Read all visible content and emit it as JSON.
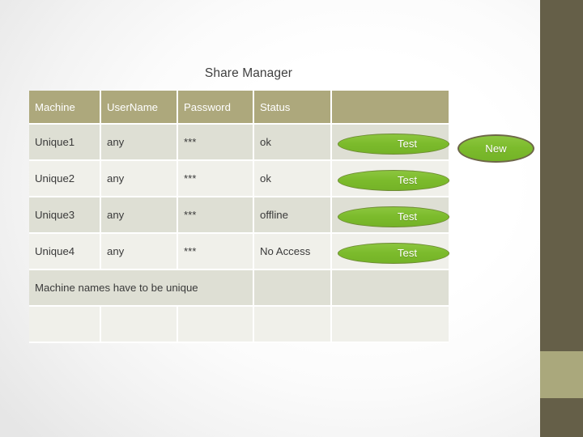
{
  "slide": {
    "title": "Share Manager"
  },
  "table": {
    "headers": [
      "Machine",
      "UserName",
      "Password",
      "Status",
      ""
    ],
    "rows": [
      {
        "machine": "Unique1",
        "username": "any",
        "password": "***",
        "status": "ok",
        "action_label": "Test"
      },
      {
        "machine": "Unique2",
        "username": "any",
        "password": "***",
        "status": "ok",
        "action_label": "Test"
      },
      {
        "machine": "Unique3",
        "username": "any",
        "password": "***",
        "status": "offline",
        "action_label": "Test"
      },
      {
        "machine": "Unique4",
        "username": "any",
        "password": "***",
        "status": "No Access",
        "action_label": "Test"
      }
    ],
    "note_row": {
      "note": "Machine names have to be unique"
    }
  },
  "actions": {
    "new_label": "New"
  },
  "colors": {
    "header_bg": "#ada87c",
    "row_odd_bg": "#dedfd4",
    "row_even_bg": "#f0f0ea",
    "button_green": "#7cbb2c",
    "sidebar_dark": "#655f48",
    "sidebar_accent": "#aaa87c",
    "title_text": "#3f3f3f"
  }
}
